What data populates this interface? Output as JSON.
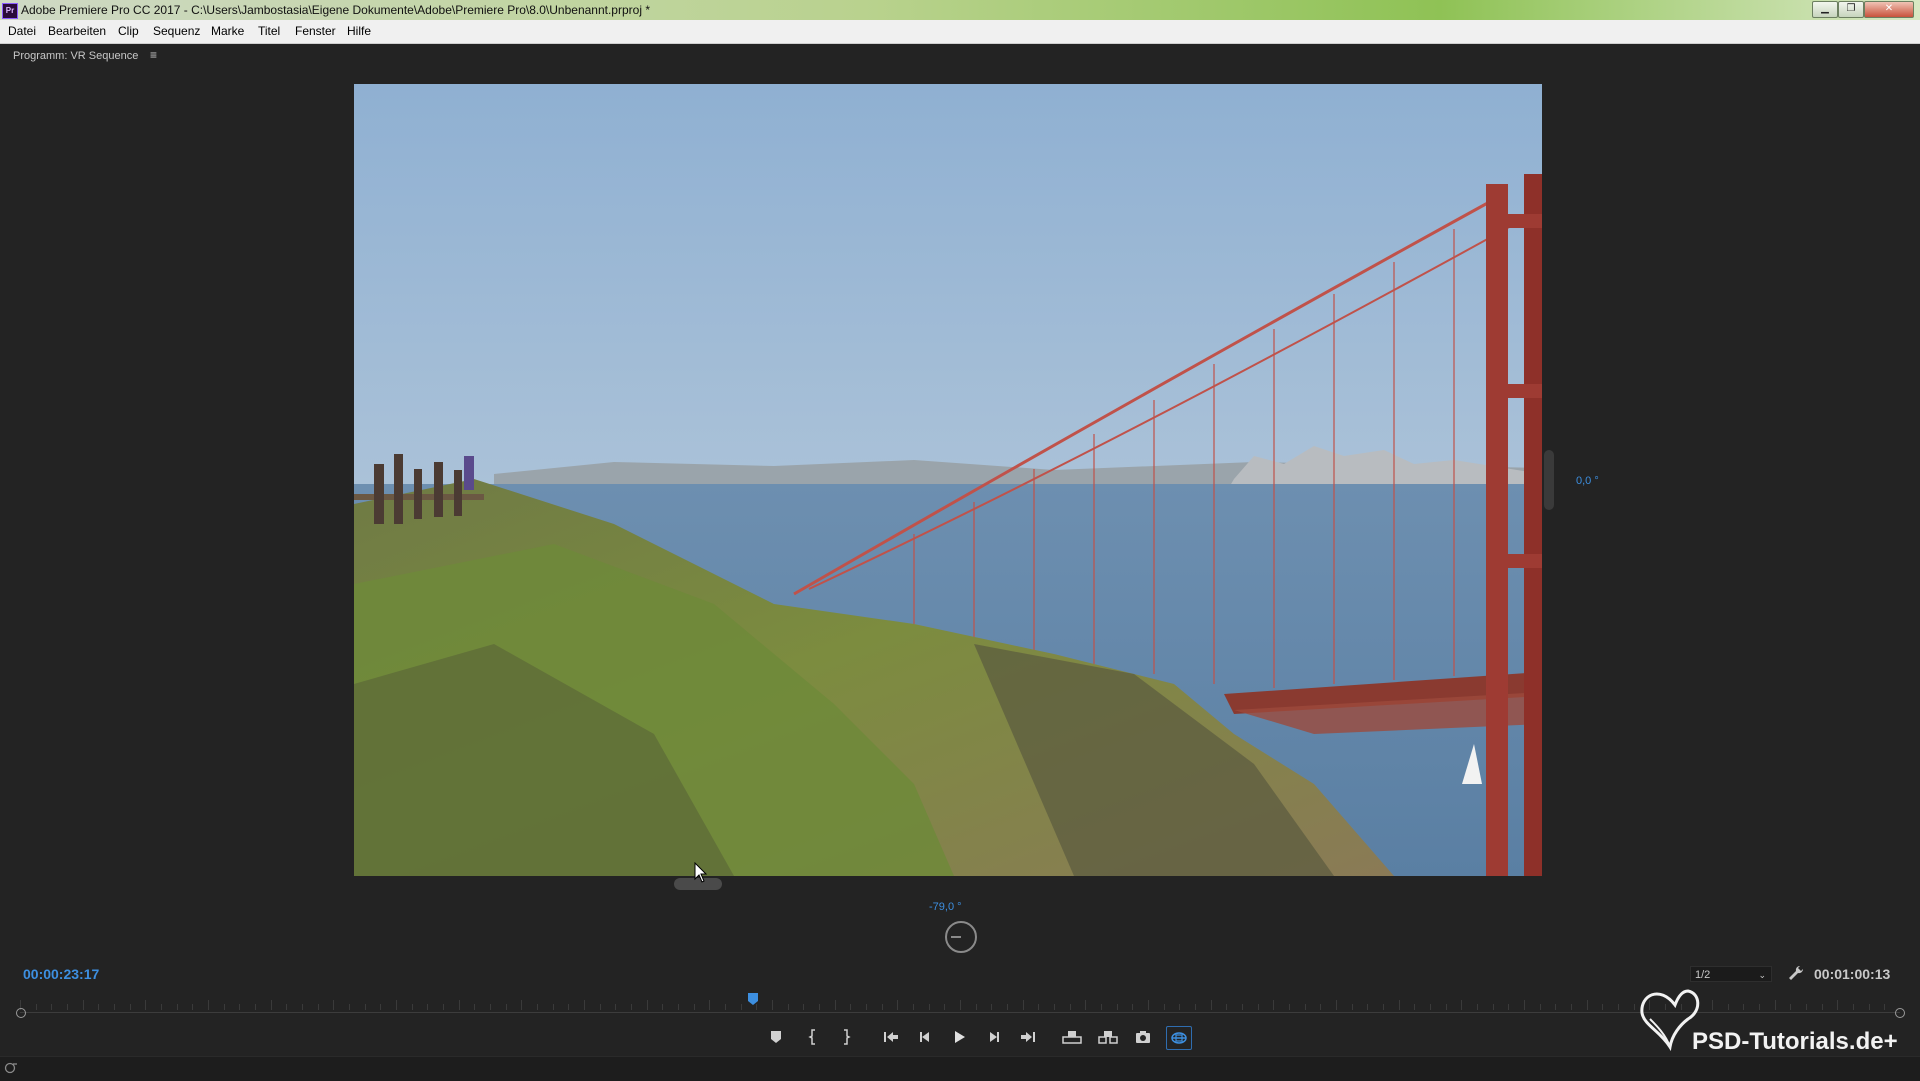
{
  "window": {
    "title": "Adobe Premiere Pro CC 2017 - C:\\Users\\Jambostasia\\Eigene Dokumente\\Adobe\\Premiere Pro\\8.0\\Unbenannt.prproj *",
    "app_icon": "Pr",
    "controls": {
      "minimize": "minimize-icon",
      "maximize": "maximize-icon",
      "close": "close-icon"
    }
  },
  "menu": {
    "items": [
      "Datei",
      "Bearbeiten",
      "Clip",
      "Sequenz",
      "Marke",
      "Titel",
      "Fenster",
      "Hilfe"
    ]
  },
  "panel": {
    "title": "Programm: VR Sequence",
    "menu_icon": "≡"
  },
  "vr": {
    "horizontal_angle": "0,0 °",
    "vertical_angle": "-79,0 °"
  },
  "timecode": {
    "current": "00:00:23:17",
    "duration": "00:01:00:13"
  },
  "resolution": {
    "selected": "1/2"
  },
  "timeline": {
    "playhead_fraction": 0.39
  },
  "transport": {
    "buttons": [
      {
        "name": "add-marker",
        "icon": "marker-icon"
      },
      {
        "name": "mark-in",
        "icon": "mark-in-icon"
      },
      {
        "name": "mark-out",
        "icon": "mark-out-icon"
      },
      {
        "name": "go-to-in",
        "icon": "go-to-in-icon"
      },
      {
        "name": "step-back",
        "icon": "step-back-icon"
      },
      {
        "name": "play",
        "icon": "play-icon"
      },
      {
        "name": "step-forward",
        "icon": "step-forward-icon"
      },
      {
        "name": "go-to-out",
        "icon": "go-to-out-icon"
      },
      {
        "name": "lift",
        "icon": "lift-icon"
      },
      {
        "name": "extract",
        "icon": "extract-icon"
      },
      {
        "name": "export-frame",
        "icon": "camera-icon"
      },
      {
        "name": "vr-video",
        "icon": "vr-icon"
      }
    ]
  },
  "colors": {
    "accent_blue": "#3d8fe0",
    "panel_bg": "#232323"
  },
  "watermark": {
    "text": "PSD-Tutorials.de+"
  }
}
